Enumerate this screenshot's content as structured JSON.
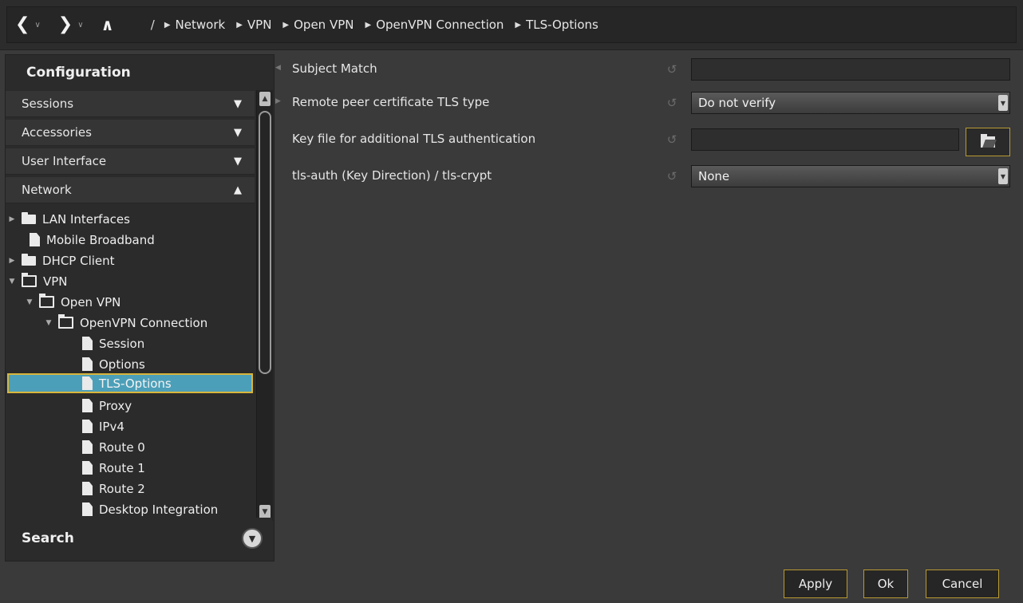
{
  "topbar": {
    "back_icon": "chevron-left-icon",
    "forward_icon": "chevron-right-icon",
    "up_icon": "chevron-up-icon",
    "root": "/",
    "breadcrumbs": [
      "Network",
      "VPN",
      "Open VPN",
      "OpenVPN Connection",
      "TLS-Options"
    ]
  },
  "sidebar": {
    "title": "Configuration",
    "categories": [
      {
        "label": "Sessions",
        "state": "collapsed"
      },
      {
        "label": "Accessories",
        "state": "collapsed"
      },
      {
        "label": "User Interface",
        "state": "collapsed"
      },
      {
        "label": "Network",
        "state": "expanded"
      }
    ],
    "tree": [
      {
        "label": "LAN Interfaces",
        "icon": "folder-icon"
      },
      {
        "label": "Mobile Broadband",
        "icon": "file-icon"
      },
      {
        "label": "DHCP Client",
        "icon": "folder-icon"
      },
      {
        "label": "VPN",
        "icon": "folder-open-icon"
      },
      {
        "label": "Open VPN",
        "icon": "folder-open-icon"
      },
      {
        "label": "OpenVPN Connection",
        "icon": "folder-open-icon"
      },
      {
        "label": "Session",
        "icon": "file-icon"
      },
      {
        "label": "Options",
        "icon": "file-icon"
      },
      {
        "label": "TLS-Options",
        "icon": "file-icon",
        "selected": true
      },
      {
        "label": "Proxy",
        "icon": "file-icon"
      },
      {
        "label": "IPv4",
        "icon": "file-icon"
      },
      {
        "label": "Route 0",
        "icon": "file-icon"
      },
      {
        "label": "Route 1",
        "icon": "file-icon"
      },
      {
        "label": "Route 2",
        "icon": "file-icon"
      },
      {
        "label": "Desktop Integration",
        "icon": "file-icon"
      }
    ],
    "search_label": "Search"
  },
  "main": {
    "fields": [
      {
        "label": "Subject Match",
        "value": ""
      },
      {
        "label": "Remote peer certificate TLS type",
        "value": "Do not verify"
      },
      {
        "label": "Key file for additional TLS authentication",
        "value": ""
      },
      {
        "label": "tls-auth (Key Direction) / tls-crypt",
        "value": "None"
      }
    ]
  },
  "buttons": {
    "apply": "Apply",
    "ok": "Ok",
    "cancel": "Cancel"
  },
  "colors": {
    "selection": "#4c9fb8",
    "focus_border": "#d8b53d",
    "button_border": "#b89a32"
  }
}
